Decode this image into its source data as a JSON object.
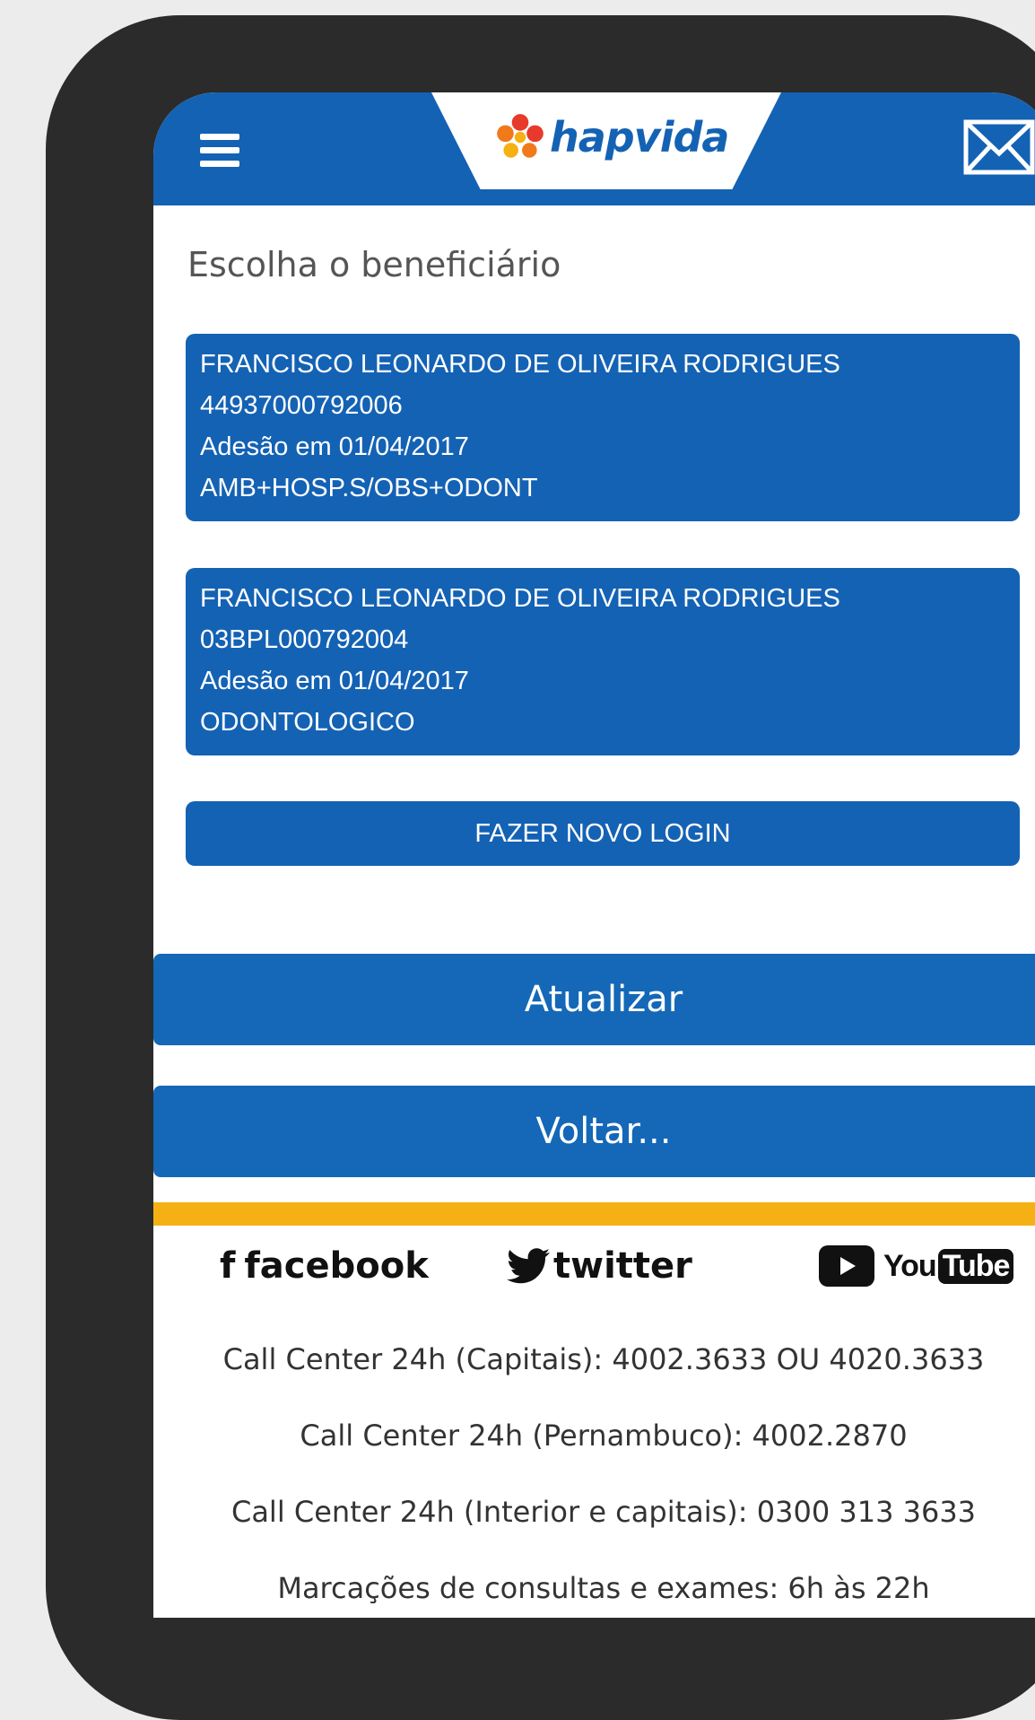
{
  "header": {
    "logo_text": "hapvida",
    "brand_color": "#1462b4",
    "accent_color": "#f5b114"
  },
  "main": {
    "subtitle": "Escolha o beneficiário",
    "beneficiaries": [
      {
        "name": "FRANCISCO LEONARDO DE OLIVEIRA RODRIGUES",
        "card_number": "44937000792006",
        "adhesion": "Adesão em 01/04/2017",
        "plan": "AMB+HOSP.S/OBS+ODONT"
      },
      {
        "name": "FRANCISCO LEONARDO DE OLIVEIRA RODRIGUES",
        "card_number": "03BPL000792004",
        "adhesion": "Adesão em 01/04/2017",
        "plan": "ODONTOLOGICO"
      }
    ],
    "new_login_label": "FAZER NOVO LOGIN",
    "update_label": "Atualizar",
    "back_label": "Voltar..."
  },
  "footer": {
    "social": {
      "facebook_f": "f",
      "facebook": "facebook",
      "twitter": "twitter",
      "youtube_you": "You",
      "youtube_tube": "Tube"
    },
    "contacts": [
      "Call Center 24h (Capitais): 4002.3633 OU 4020.3633",
      "Call Center 24h (Pernambuco): 4002.2870",
      "Call Center 24h (Interior e capitais): 0300 313 3633",
      "Marcações de consultas e exames: 6h às 22h"
    ]
  }
}
